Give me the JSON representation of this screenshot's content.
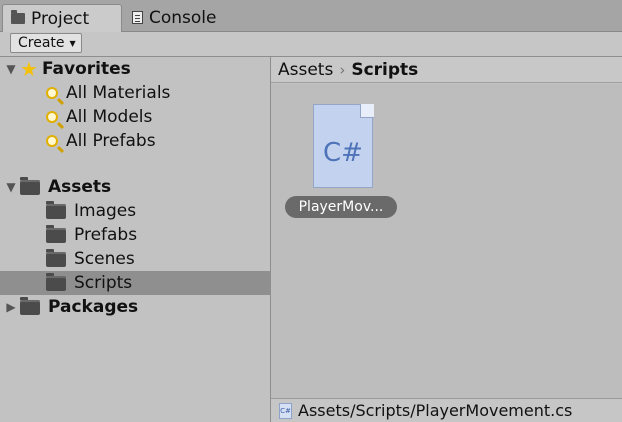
{
  "tabs": [
    {
      "label": "Project",
      "icon": "folder-icon",
      "active": true
    },
    {
      "label": "Console",
      "icon": "console-icon",
      "active": false
    }
  ],
  "toolbar": {
    "create_label": "Create",
    "create_caret": "▼"
  },
  "tree": {
    "favorites": {
      "label": "Favorites",
      "icon": "star-icon",
      "arrow": "▼",
      "items": [
        {
          "label": "All Materials",
          "icon": "search-icon"
        },
        {
          "label": "All Models",
          "icon": "search-icon"
        },
        {
          "label": "All Prefabs",
          "icon": "search-icon"
        }
      ]
    },
    "assets": {
      "label": "Assets",
      "icon": "folder-icon",
      "arrow": "▼",
      "items": [
        {
          "label": "Images",
          "icon": "folder-icon"
        },
        {
          "label": "Prefabs",
          "icon": "folder-icon"
        },
        {
          "label": "Scenes",
          "icon": "folder-icon"
        },
        {
          "label": "Scripts",
          "icon": "folder-icon",
          "selected": true
        }
      ]
    },
    "packages": {
      "label": "Packages",
      "icon": "folder-icon",
      "arrow": "▶"
    }
  },
  "breadcrumb": {
    "root": "Assets",
    "separator": "›",
    "current": "Scripts"
  },
  "asset_item": {
    "glyph": "C#",
    "label": "PlayerMov..."
  },
  "status": {
    "icon_text": "C#",
    "path": "Assets/Scripts/PlayerMovement.cs"
  },
  "colors": {
    "selected_row": "#8f8f8f",
    "script_blue": "#4f73b8",
    "star": "#f3c10c"
  }
}
